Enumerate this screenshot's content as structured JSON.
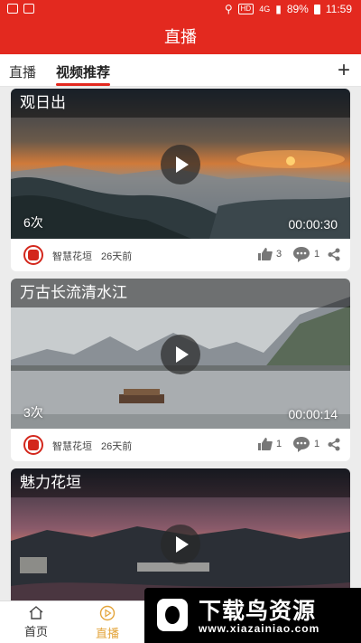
{
  "status_bar": {
    "carrier_badge": "HD",
    "network": "4G",
    "battery": "89%",
    "time": "11:59"
  },
  "header": {
    "title": "直播"
  },
  "tabs": [
    {
      "label": "直播",
      "active": false
    },
    {
      "label": "视频推荐",
      "active": true
    }
  ],
  "add_label": "+",
  "videos": [
    {
      "title": "观日出",
      "views": "6次",
      "duration": "00:00:30",
      "source": "智慧花垣",
      "age": "26天前",
      "likes": "3",
      "comments": "1"
    },
    {
      "title": "万古长流清水江",
      "views": "3次",
      "duration": "00:00:14",
      "source": "智慧花垣",
      "age": "26天前",
      "likes": "1",
      "comments": "1"
    },
    {
      "title": "魅力花垣",
      "views": "",
      "duration": "",
      "source": "",
      "age": "",
      "likes": "",
      "comments": ""
    }
  ],
  "bottom_nav": [
    {
      "label": "首页",
      "icon": "home-icon",
      "active": false
    },
    {
      "label": "直播",
      "icon": "play-circle-icon",
      "active": true
    }
  ],
  "watermark": {
    "text": "下载鸟资源",
    "url": "www.xiazainiao.com"
  },
  "colors": {
    "brand_red": "#e3291f",
    "active_nav": "#e3a43a"
  }
}
